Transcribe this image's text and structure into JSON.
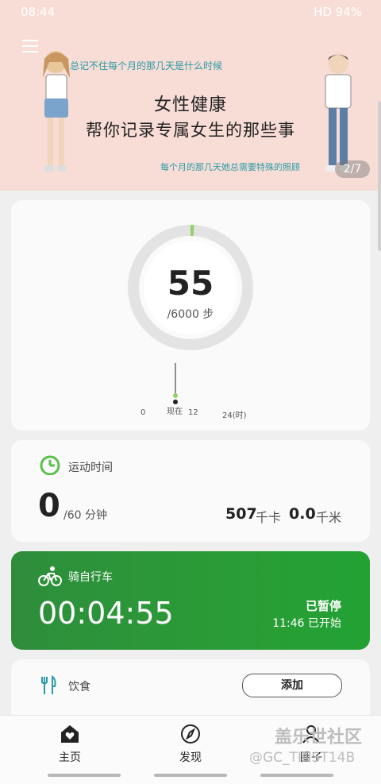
{
  "status_bar": {
    "time": "08:44",
    "right": "HD 94%"
  },
  "banner": {
    "top_text": "总记不住每个月的那几天是什么时候",
    "title": "女性健康",
    "subtitle": "帮你记录专属女生的那些事",
    "bottom_text": "每个月的那几天她总需要特殊的照顾",
    "page_indicator": "2/7"
  },
  "steps": {
    "count": "55",
    "goal": "/6000 步",
    "progress_fraction": 0.009,
    "axis": {
      "start": "0",
      "now": "现在",
      "mid": "12",
      "end": "24(时)"
    }
  },
  "exercise": {
    "title": "运动时间",
    "minutes": "0",
    "unit": "/60 分钟",
    "calories": "507",
    "calories_unit": "千卡",
    "distance": "0.0",
    "distance_unit": "千米"
  },
  "cycling": {
    "title": "骑自行车",
    "timer": "00:04:55",
    "status": "已暂停",
    "started": "11:46 已开始"
  },
  "diet": {
    "title": "饮食",
    "add_label": "添加"
  },
  "nav": {
    "home": "主页",
    "discover": "发现",
    "circle": "圈子"
  },
  "watermark": {
    "line1": "盖乐世社区",
    "line2": "@GC_TINST14B"
  },
  "colors": {
    "accent_green": "#2a9c36",
    "banner_bg": "#f7ddd5",
    "teal_text": "#2a9aa8"
  }
}
